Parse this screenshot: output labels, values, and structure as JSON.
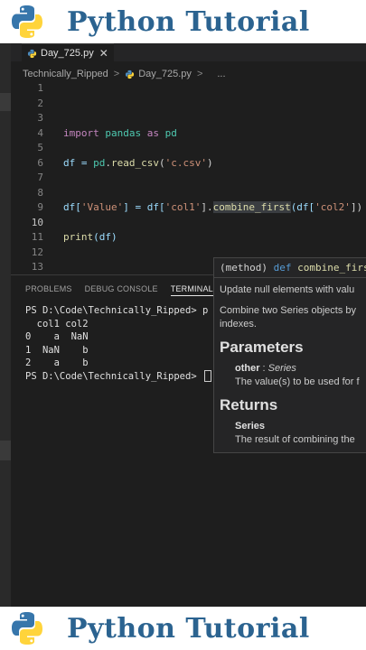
{
  "banner": {
    "title": "Python Tutorial"
  },
  "tab": {
    "filename": "Day_725.py",
    "close": "✕"
  },
  "breadcrumb": {
    "folder": "Technically_Ripped",
    "sep": ">",
    "file": "Day_725.py",
    "more": "..."
  },
  "code_lines": [
    {
      "n": "1"
    },
    {
      "n": "2"
    },
    {
      "n": "3"
    },
    {
      "n": "4",
      "kw_import": "import",
      "mod": "pandas",
      "kw_as": "as",
      "alias": "pd"
    },
    {
      "n": "5"
    },
    {
      "n": "6",
      "text_a": "df = ",
      "text_b": "pd",
      "text_c": ".",
      "fn": "read_csv",
      "p1": "(",
      "str": "'c.csv'",
      "p2": ")"
    },
    {
      "n": "7"
    },
    {
      "n": "8"
    },
    {
      "n": "9",
      "a": "df[",
      "s1": "'Value'",
      "b": "] = df[",
      "s2": "'col1'",
      "c": "].",
      "fn": "combine_first",
      "d": "(df[",
      "s3": "'col2'",
      "e": "])"
    },
    {
      "n": "10"
    },
    {
      "n": "11",
      "fn": "print",
      "rest": "(df)"
    },
    {
      "n": "12"
    },
    {
      "n": "13"
    }
  ],
  "panel": {
    "tabs": [
      "PROBLEMS",
      "DEBUG CONSOLE",
      "TERMINAL"
    ],
    "terminal": [
      "PS D:\\Code\\Technically_Ripped> p",
      "  col1 col2",
      "0    a  NaN",
      "1  NaN    b",
      "2    a    b",
      "PS D:\\Code\\Technically_Ripped> "
    ]
  },
  "hover": {
    "signature_a": "(method) ",
    "signature_kw": "def",
    "signature_fn": " combine_first",
    "summary": "Update null elements with valu",
    "desc1": "Combine two Series objects by",
    "desc2": "indexes.",
    "parameters_heading": "Parameters",
    "param_name": "other",
    "param_sep": " : ",
    "param_type": "Series",
    "param_desc": "The value(s) to be used for f",
    "returns_heading": "Returns",
    "return_type": "Series",
    "return_desc": "The result of combining the"
  },
  "colors": {
    "banner_text": "#2b6390",
    "python_blue": "#3776ab",
    "python_yellow": "#ffd43b"
  }
}
